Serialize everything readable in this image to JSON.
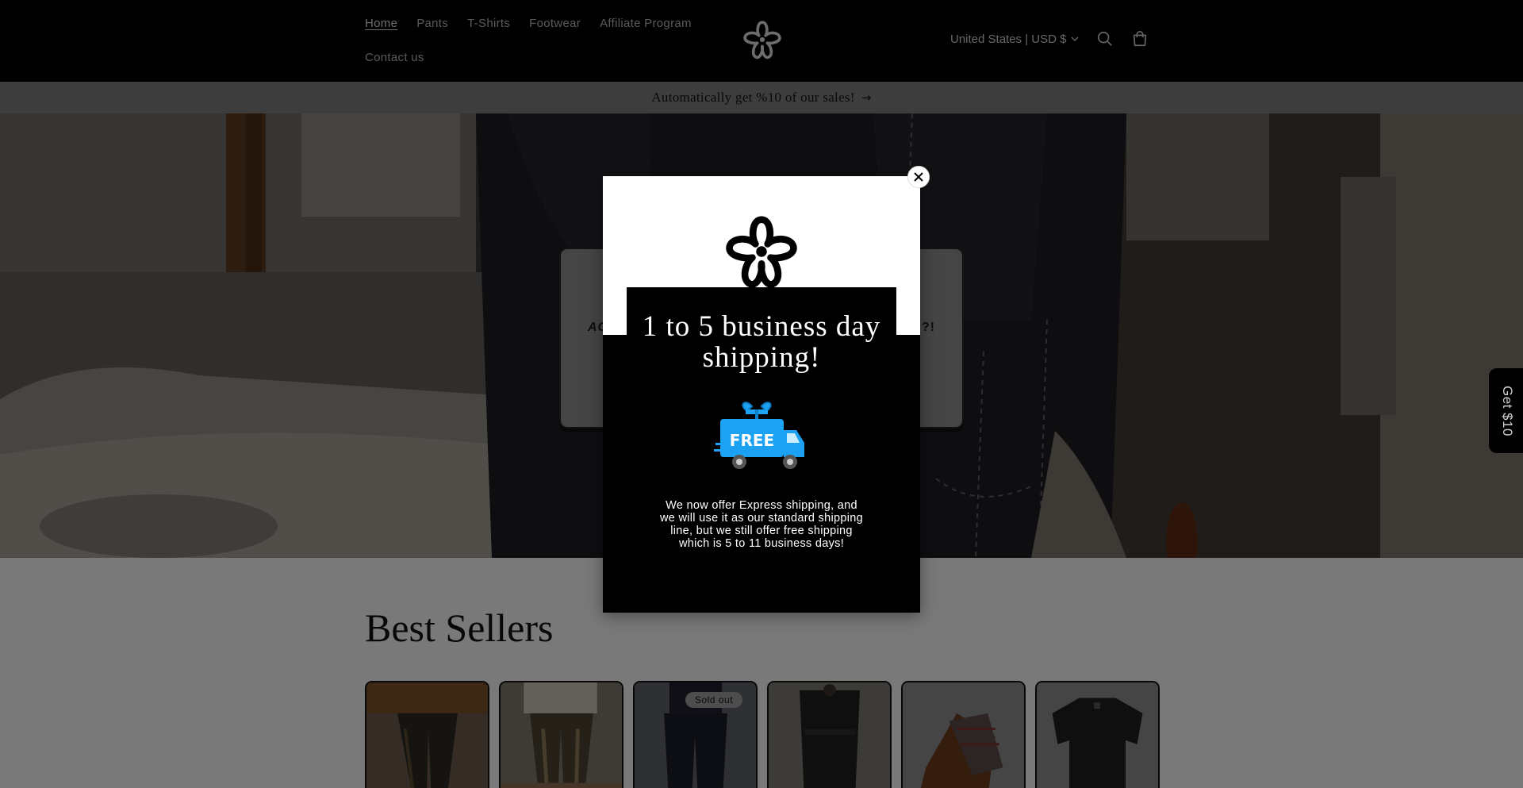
{
  "header": {
    "nav_row1": [
      "Home",
      "Pants",
      "T-Shirts",
      "Footwear",
      "Affiliate Program"
    ],
    "nav_row2": [
      "Contact us"
    ],
    "country_selector": "United States | USD $",
    "icons": {
      "logo": "flower-logo-icon",
      "search": "search-icon",
      "cart": "cart-icon",
      "chevron": "chevron-down-icon"
    }
  },
  "announcement": {
    "text": "Automatically get %10 of our sales!",
    "arrow": "→"
  },
  "hero_card": {
    "peek_left": "AC",
    "peek_right": "?!"
  },
  "best_sellers": {
    "title": "Best Sellers",
    "products": [
      {
        "badge": ""
      },
      {
        "badge": ""
      },
      {
        "badge": "Sold out"
      },
      {
        "badge": ""
      },
      {
        "badge": ""
      },
      {
        "badge": ""
      }
    ]
  },
  "side_tab": {
    "label": "Get $10"
  },
  "popup": {
    "heading": "1 to 5 business day shipping!",
    "truck_label": "FREE",
    "body": "We now offer Express shipping, and we will use it as our standard shipping line, but we still offer free shipping which is 5 to 11 business days!",
    "close_icon": "close-icon"
  },
  "colors": {
    "header_bg": "#000000",
    "truck_blue": "#1da1f2",
    "popup_text": "#ffffff"
  }
}
